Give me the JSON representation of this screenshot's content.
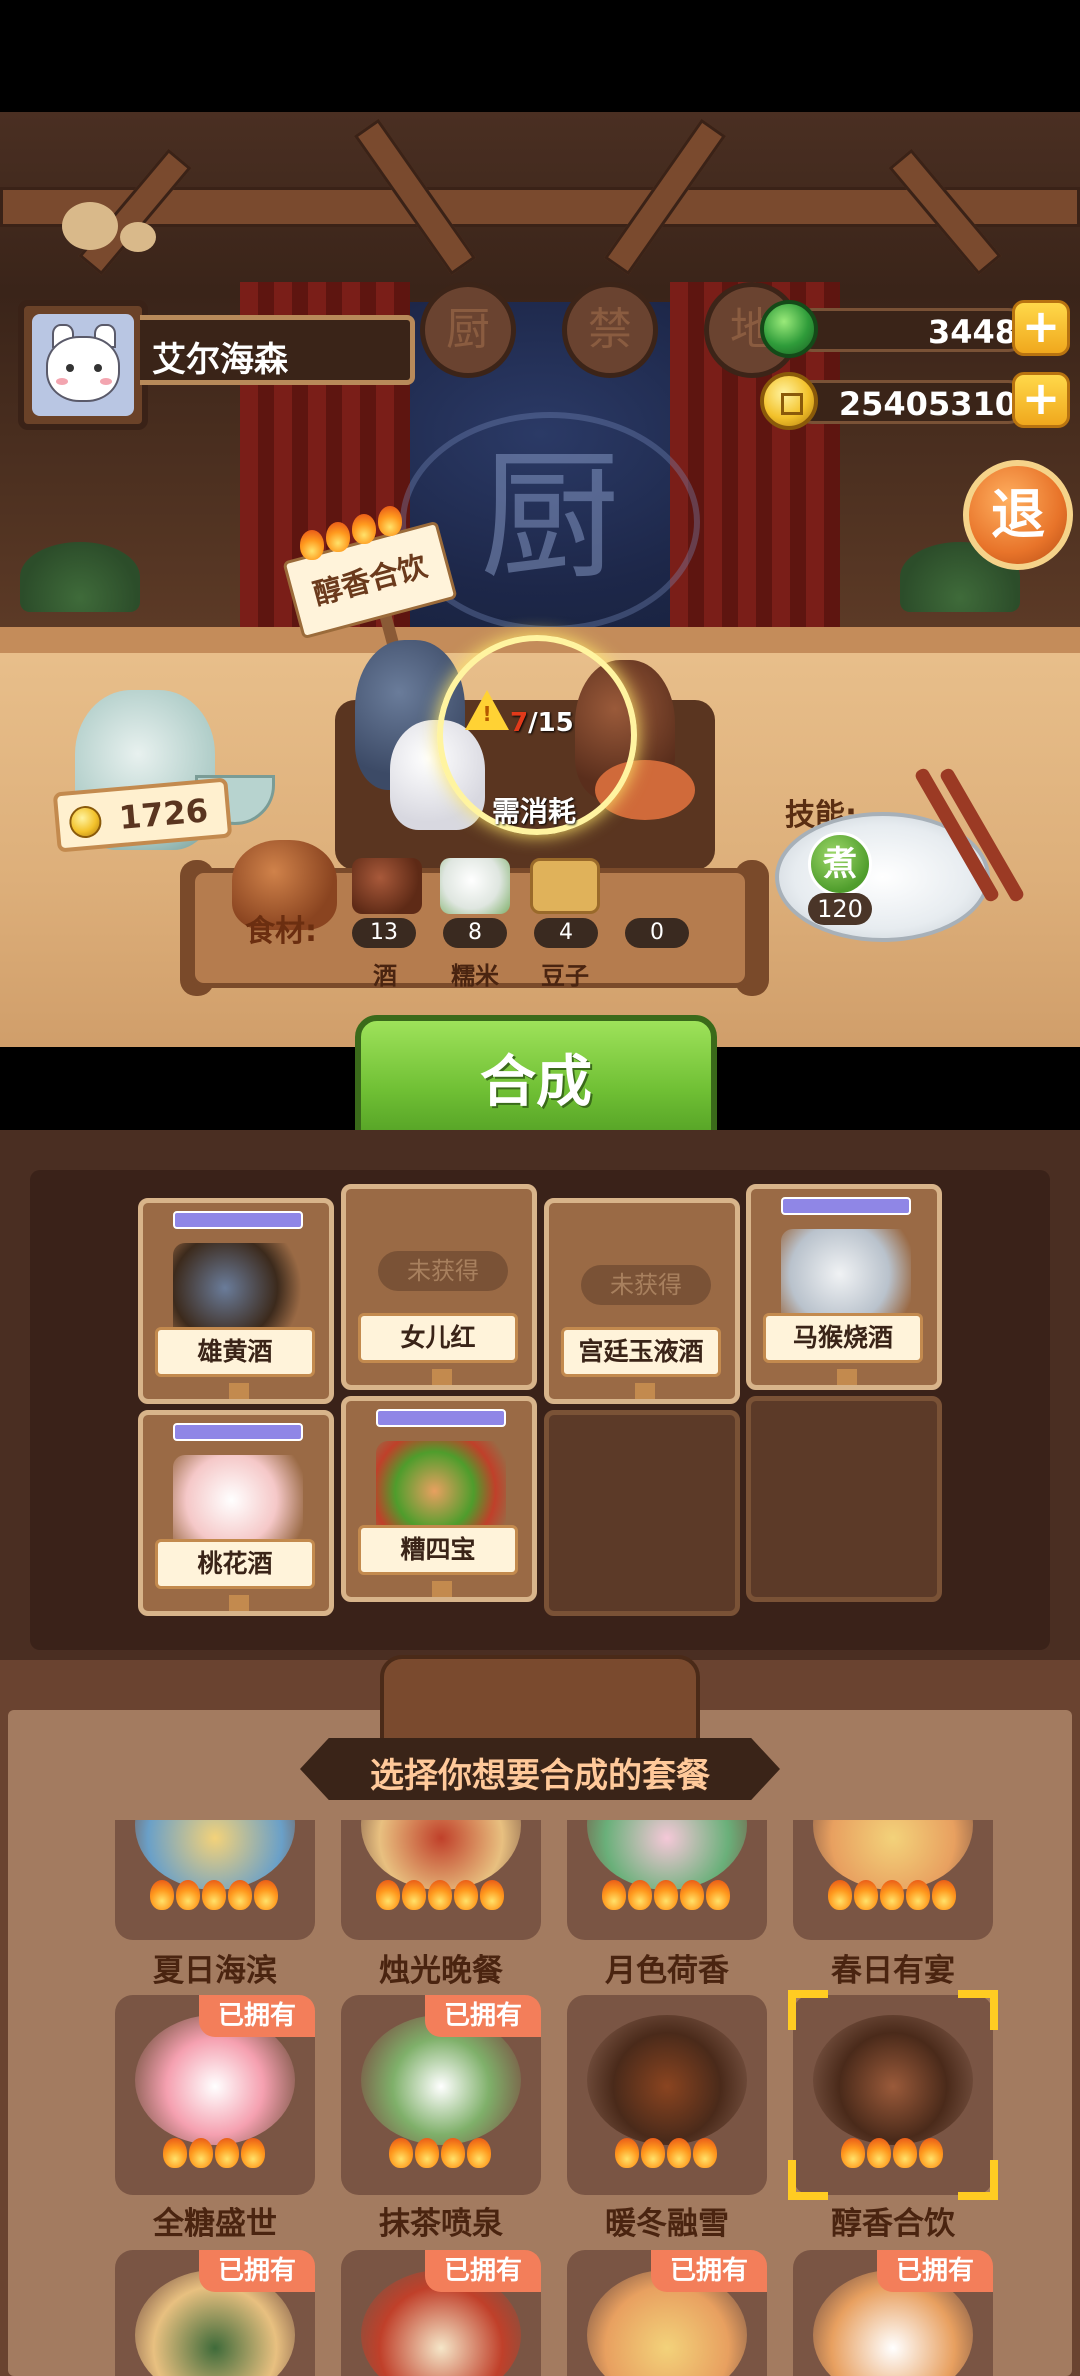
{
  "player": {
    "name": "艾尔海森"
  },
  "currency": {
    "jade": "3448",
    "coins": "25405310"
  },
  "buttons": {
    "exit": "退",
    "craft": "合成"
  },
  "scene": {
    "kitchen_sign": [
      "厨",
      "禁",
      "地"
    ]
  },
  "recipe": {
    "name": "醇香合饮",
    "progress_current": "7",
    "progress_total": "/15",
    "need_cost": "需消耗",
    "sell_price": "1726",
    "flames": 4
  },
  "skill": {
    "label": "技能:",
    "badge": "煮",
    "value": "120"
  },
  "ingredients": {
    "title": "食材:",
    "items": [
      {
        "name": "酒",
        "count": "13"
      },
      {
        "name": "糯米",
        "count": "8"
      },
      {
        "name": "豆子",
        "count": "4"
      },
      {
        "name": "",
        "count": "0"
      }
    ]
  },
  "inventory": {
    "slots": [
      {
        "label": "雄黄酒",
        "state": "owned"
      },
      {
        "label": "女儿红",
        "state": "locked",
        "lock_text": "未获得"
      },
      {
        "label": "宫廷玉液酒",
        "state": "locked",
        "lock_text": "未获得"
      },
      {
        "label": "马猴烧酒",
        "state": "owned"
      },
      {
        "label": "桃花酒",
        "state": "owned"
      },
      {
        "label": "糟四宝",
        "state": "owned"
      },
      {
        "label": "",
        "state": "empty"
      },
      {
        "label": "",
        "state": "empty"
      }
    ]
  },
  "sets": {
    "title": "选择你想要合成的套餐",
    "owned_badge": "已拥有",
    "cards": [
      {
        "name": "夏日海滨",
        "owned": false
      },
      {
        "name": "烛光晚餐",
        "owned": false
      },
      {
        "name": "月色荷香",
        "owned": false
      },
      {
        "name": "春日有宴",
        "owned": false
      },
      {
        "name": "全糖盛世",
        "owned": true
      },
      {
        "name": "抹茶喷泉",
        "owned": true
      },
      {
        "name": "暖冬融雪",
        "owned": false
      },
      {
        "name": "醇香合饮",
        "owned": false,
        "selected": true
      },
      {
        "name": "",
        "owned": true
      },
      {
        "name": "",
        "owned": true
      },
      {
        "name": "",
        "owned": true
      },
      {
        "name": "",
        "owned": true
      }
    ]
  },
  "colors": {
    "accent_green": "#6fbf34",
    "owned_badge": "#f37e5a",
    "select_frame": "#ffcc22"
  }
}
